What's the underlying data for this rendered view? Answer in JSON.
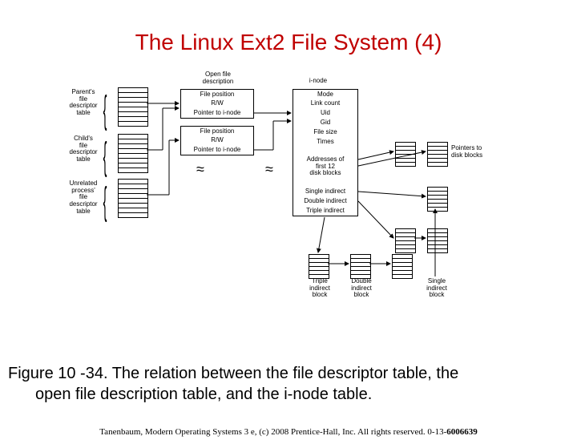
{
  "title": "The Linux Ext2 File System (4)",
  "headers": {
    "open_file_desc": "Open file\ndescription",
    "inode": "i-node"
  },
  "fd_tables": {
    "parent": "Parent's\nfile\ndescriptor\ntable",
    "child": "Child's\nfile\ndescriptor\ntable",
    "unrelated": "Unrelated\nprocess'\nfile\ndescriptor\ntable"
  },
  "ofd_rows": {
    "pos": "File position",
    "rw": "R/W",
    "ptr": "Pointer to i-node"
  },
  "inode_rows": {
    "mode": "Mode",
    "link": "Link count",
    "uid": "Uid",
    "gid": "Gid",
    "size": "File size",
    "times": "Times",
    "addrs": "Addresses of\nfirst 12\ndisk blocks",
    "single": "Single indirect",
    "double": "Double indirect",
    "triple": "Triple indirect"
  },
  "block_labels": {
    "ptrs": "Pointers to\ndisk blocks",
    "single": "Single\nindirect\nblock",
    "double": "Double\nindirect\nblock",
    "triple": "Triple\nindirect\nblock"
  },
  "caption_l1": "Figure 10 -34. The relation between the file descriptor table, the",
  "caption_l2": "open file description table, and the i-node table.",
  "footer_text": "Tanenbaum, Modern Operating Systems 3 e, (c) 2008 Prentice-Hall, Inc. All rights reserved. 0-13-",
  "footer_isbn": "6006639"
}
